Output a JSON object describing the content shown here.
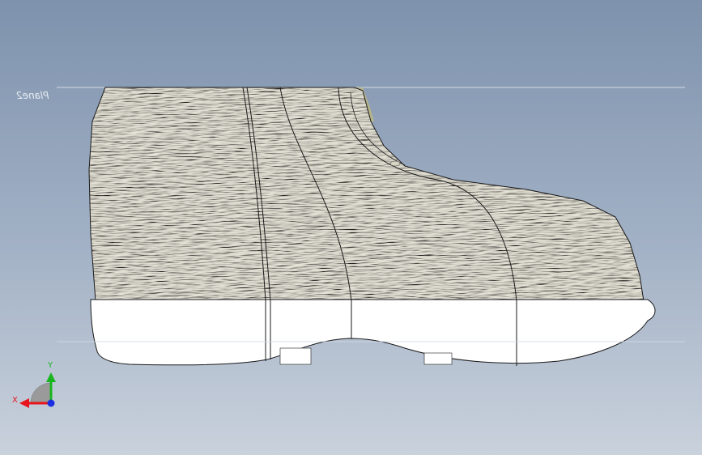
{
  "viewport": {
    "plane_label": "Plane2",
    "background_top": "#7e92ad",
    "background_bottom": "#c9d1dc"
  },
  "model": {
    "upper_color": "#e2dfd2",
    "upper_shadow": "#c9c5b4",
    "sole_color": "#ffffff",
    "edge_color": "#1a1a1a",
    "inner_color": "#b7b48a"
  },
  "triad": {
    "x_label": "X",
    "y_label": "Y",
    "x_color": "#e8141b",
    "y_color": "#19b51f",
    "z_color": "#1a2fe0"
  }
}
